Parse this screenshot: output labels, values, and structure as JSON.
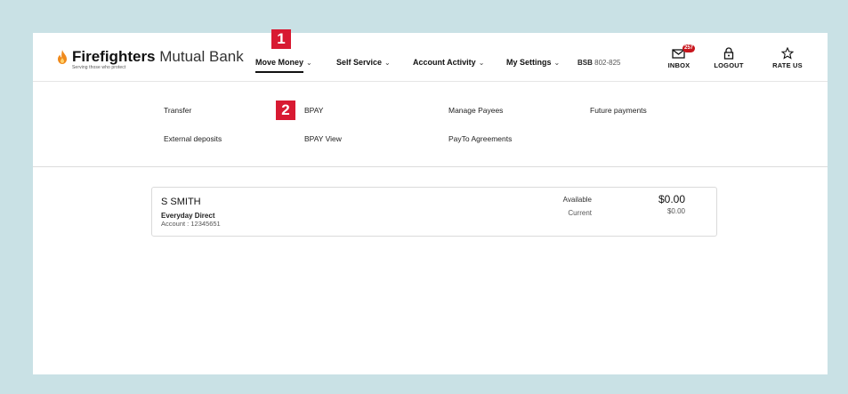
{
  "brand": {
    "name_bold": "Firefighters",
    "name_light": "Mutual Bank",
    "tagline": "Serving those who protect",
    "flame_color": "#f08a1c"
  },
  "nav": {
    "items": [
      {
        "label": "Move Money",
        "active": true
      },
      {
        "label": "Self Service"
      },
      {
        "label": "Account Activity"
      },
      {
        "label": "My Settings"
      }
    ],
    "chevron": "⌄",
    "bsb_label": "BSB",
    "bsb_value": "802-825"
  },
  "toolbar": {
    "inbox_label": "INBOX",
    "inbox_count": "257",
    "logout_label": "LOGOUT",
    "rate_label": "RATE US"
  },
  "annotations": {
    "step1": "1",
    "step2": "2",
    "color": "#d81a32"
  },
  "submenu": {
    "items": [
      "Transfer",
      "BPAY",
      "Manage Payees",
      "Future payments",
      "External deposits",
      "BPAY View",
      "PayTo Agreements"
    ]
  },
  "account": {
    "holder": "S SMITH",
    "type": "Everyday Direct",
    "number": "Account : 12345651",
    "available_label": "Available",
    "available_value": "$0.00",
    "current_label": "Current",
    "current_value": "$0.00"
  },
  "colors": {
    "page_bg": "#c9e1e5",
    "badge": "#c8161d"
  }
}
